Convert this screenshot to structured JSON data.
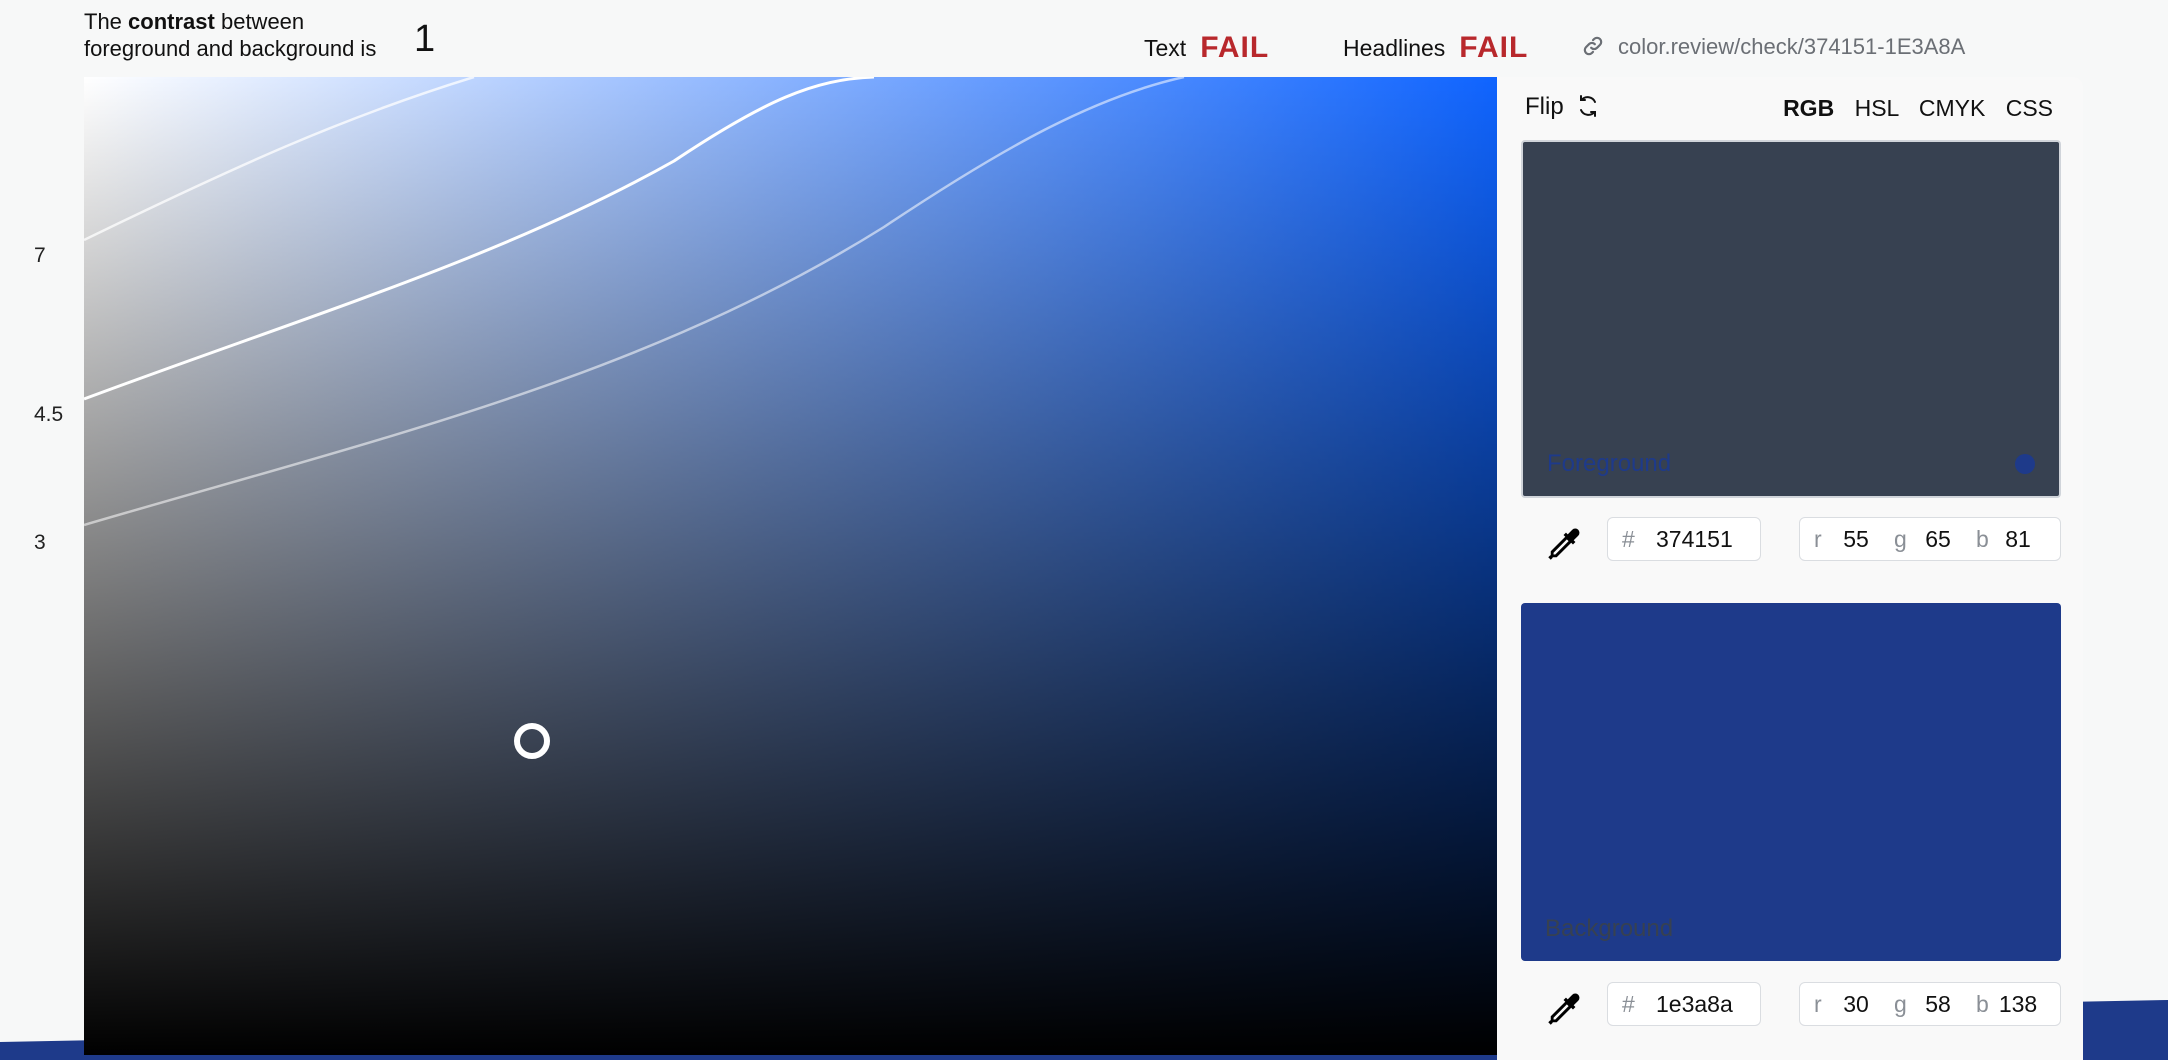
{
  "header": {
    "statement_prefix": "The",
    "statement_bold": "contrast",
    "statement_suffix": "between",
    "statement_line2": "foreground and background is",
    "ratio": "1",
    "text_label": "Text",
    "text_status": "FAIL",
    "headlines_label": "Headlines",
    "headlines_status": "FAIL",
    "share_url": "color.review/check/374151-1E3A8A"
  },
  "picker": {
    "ticks": [
      "7",
      "4.5",
      "3"
    ]
  },
  "panel": {
    "flip_label": "Flip",
    "modes": [
      "RGB",
      "HSL",
      "CMYK",
      "CSS"
    ],
    "active_mode": "RGB",
    "foreground": {
      "label": "Foreground",
      "color": "#374151",
      "hex": "374151",
      "r_label": "r",
      "g_label": "g",
      "b_label": "b",
      "r": "55",
      "g": "65",
      "b": "81"
    },
    "background": {
      "label": "Background",
      "color": "#1e3a8a",
      "hex": "1e3a8a",
      "r_label": "r",
      "g_label": "g",
      "b_label": "b",
      "r": "30",
      "g": "58",
      "b": "138"
    }
  },
  "colors": {
    "fail": "#b8282c",
    "accent_blue": "#0f64ff"
  },
  "icons": {
    "link": "link-icon",
    "flip": "refresh-icon",
    "eyedropper": "eyedropper-icon"
  }
}
